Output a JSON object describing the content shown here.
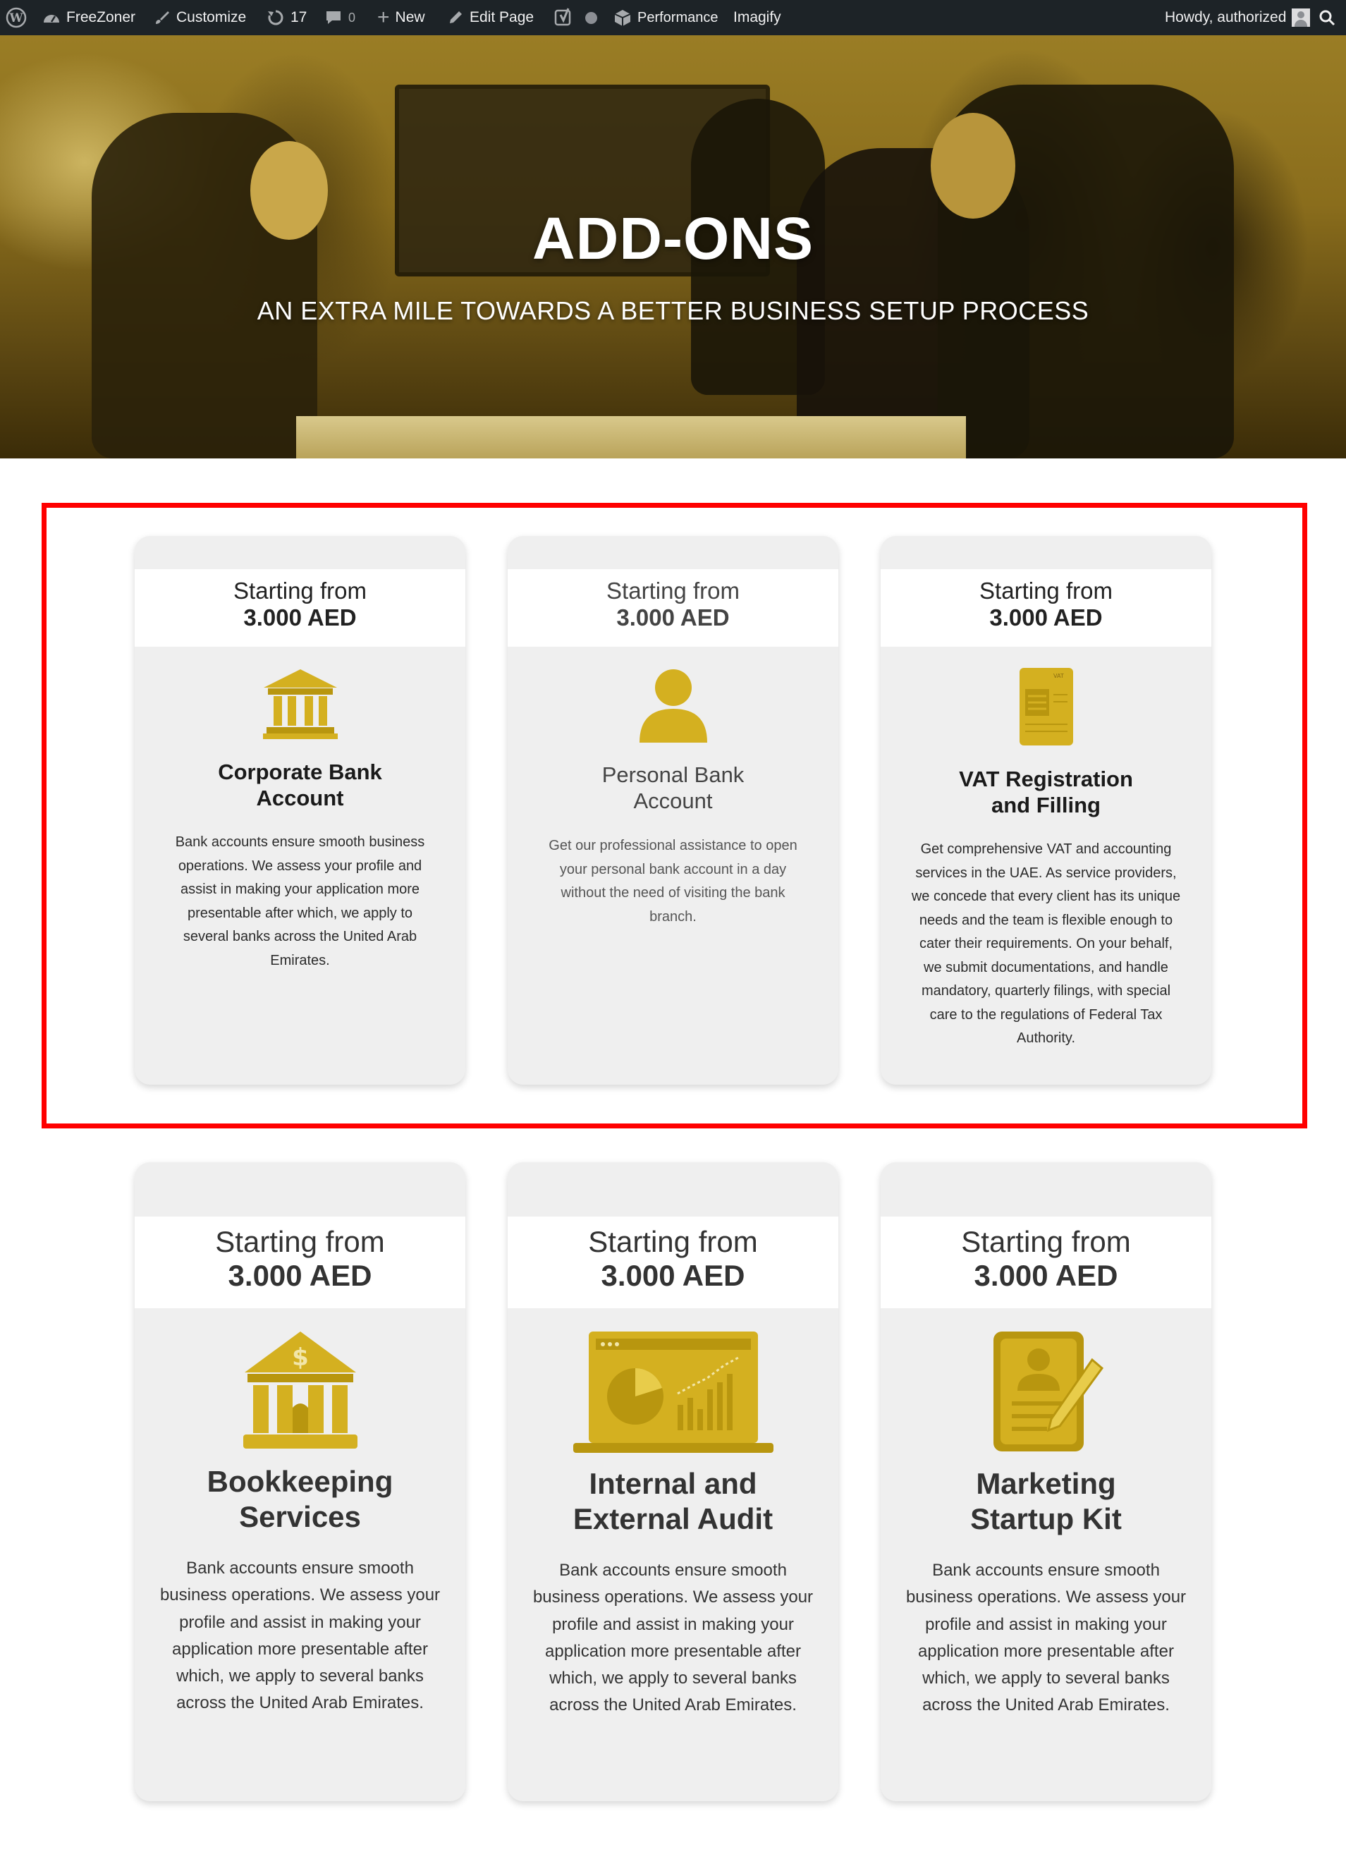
{
  "adminbar": {
    "site_name": "FreeZoner",
    "customize": "Customize",
    "updates_count": "17",
    "comments_count": "0",
    "new": "New",
    "edit_page": "Edit Page",
    "performance": "Performance",
    "imagify": "Imagify",
    "greeting": "Howdy, authorized"
  },
  "hero": {
    "title": "ADD-ONS",
    "subtitle": "AN EXTRA MILE TOWARDS A BETTER BUSINESS SETUP PROCESS"
  },
  "accent_color": "#d4b020",
  "cards_row1": [
    {
      "price_label": "Starting from",
      "price_value": "3.000 AED",
      "icon": "bank-building-icon",
      "title_line1": "Corporate Bank",
      "title_line2": "Account",
      "desc_lines": [
        "Bank accounts ensure smooth business",
        "operations. We assess your profile and",
        "assist in making your application more",
        "presentable after which, we apply to",
        "several banks across the United Arab",
        "Emirates."
      ]
    },
    {
      "price_label": "Starting from",
      "price_value": "3.000 AED",
      "icon": "person-icon",
      "title_line1": "Personal Bank",
      "title_line2": "Account",
      "desc_lines": [
        "Get our professional assistance to open",
        "your personal bank account in a day",
        "without the need of visiting the bank",
        "branch."
      ]
    },
    {
      "price_label": "Starting from",
      "price_value": "3.000 AED",
      "icon": "vat-document-icon",
      "title_line1": "VAT Registration",
      "title_line2": "and Filling",
      "desc_lines": [
        "Get comprehensive VAT and accounting",
        "services in the UAE. As service providers,",
        "we concede that every client has its unique",
        "needs and the team is flexible enough to",
        "cater their requirements. On your behalf,",
        "we submit documentations, and handle",
        "mandatory, quarterly filings, with special",
        "care to the regulations of Federal Tax",
        "Authority."
      ]
    }
  ],
  "cards_row2": [
    {
      "price_label": "Starting from",
      "price_value": "3.000 AED",
      "icon": "bank-dollar-icon",
      "title_line1": "Bookkeeping",
      "title_line2": "Services",
      "desc_lines": [
        "Bank accounts ensure smooth",
        "business operations. We assess your",
        "profile and assist in making your",
        "application more presentable after",
        "which, we apply to several banks",
        "across the United Arab Emirates."
      ]
    },
    {
      "price_label": "Starting from",
      "price_value": "3.000 AED",
      "icon": "laptop-analytics-icon",
      "title_line1": "Internal and",
      "title_line2": "External Audit",
      "desc_lines": [
        "Bank accounts ensure smooth",
        "business operations. We assess your",
        "profile and assist in making your",
        "application more presentable after",
        "which, we apply to several banks",
        "across the United Arab Emirates."
      ]
    },
    {
      "price_label": "Starting from",
      "price_value": "3.000 AED",
      "icon": "profile-document-pen-icon",
      "title_line1": "Marketing",
      "title_line2": "Startup Kit",
      "desc_lines": [
        "Bank accounts ensure smooth",
        "business operations. We assess your",
        "profile and assist in making your",
        "application more presentable after",
        "which, we apply to several banks",
        "across the United Arab Emirates."
      ]
    }
  ]
}
